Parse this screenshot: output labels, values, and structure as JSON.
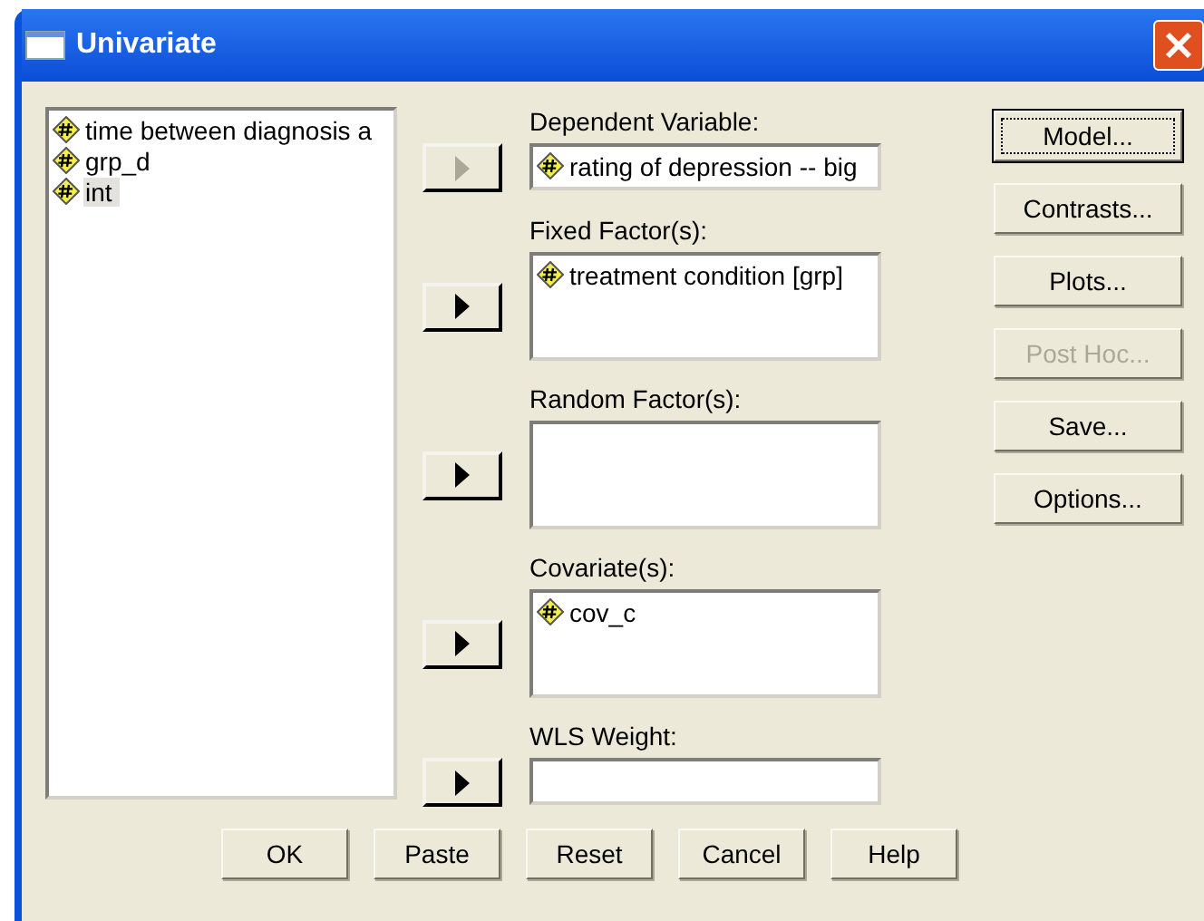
{
  "window": {
    "title": "Univariate"
  },
  "variables": [
    {
      "label": "time between diagnosis a",
      "selected": false
    },
    {
      "label": "grp_d",
      "selected": false
    },
    {
      "label": "int",
      "selected": true
    }
  ],
  "target_lists": [
    {
      "kind": "single",
      "label": "Dependent Variable:",
      "move_disabled": true,
      "items": [
        "rating of depression -- big"
      ]
    },
    {
      "kind": "multi",
      "label": "Fixed Factor(s):",
      "move_disabled": false,
      "items": [
        "treatment condition [grp]"
      ]
    },
    {
      "kind": "multi",
      "label": "Random Factor(s):",
      "move_disabled": false
    },
    {
      "kind": "multi",
      "label": "Covariate(s):",
      "move_disabled": false,
      "items": [
        "cov_c"
      ]
    },
    {
      "kind": "single",
      "label": "WLS Weight:",
      "move_disabled": false
    }
  ],
  "side_buttons": [
    {
      "label": "Model...",
      "default": true,
      "disabled": false
    },
    {
      "label": "Contrasts...",
      "default": false,
      "disabled": false
    },
    {
      "label": "Plots...",
      "default": false,
      "disabled": false
    },
    {
      "label": "Post Hoc...",
      "default": false,
      "disabled": true
    },
    {
      "label": "Save...",
      "default": false,
      "disabled": false
    },
    {
      "label": "Options...",
      "default": false,
      "disabled": false
    }
  ],
  "bottom_buttons": [
    "OK",
    "Paste",
    "Reset",
    "Cancel",
    "Help"
  ]
}
